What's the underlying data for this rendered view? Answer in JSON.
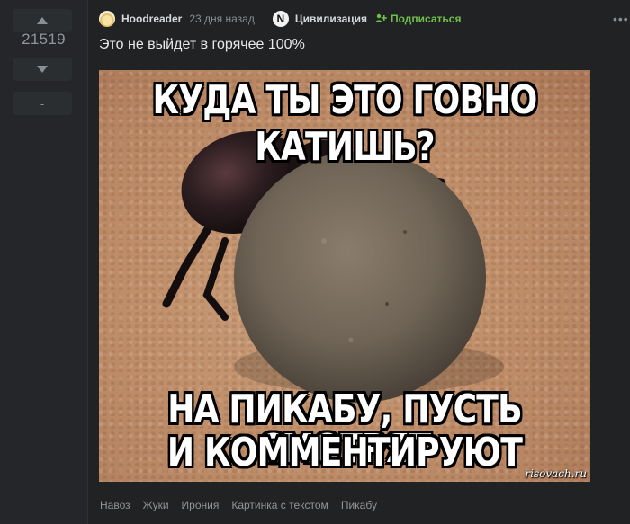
{
  "vote": {
    "rating": "21519",
    "minus_label": "-"
  },
  "header": {
    "author": "Hoodreader",
    "time": "23 дня назад",
    "community_icon_letter": "N",
    "community": "Цивилизация",
    "subscribe": "Подписаться",
    "subscribe_color": "#6fbf4a"
  },
  "story": {
    "title": "Это не выйдет в горячее 100%"
  },
  "meme": {
    "top_line_1": "КУДА ТЫ ЭТО ГОВНО",
    "top_line_2": "КАТИШЬ?",
    "bottom_line_1": "НА ПИКАБУ, ПУСТЬ СМОТРЯТ",
    "bottom_line_2": "И КОММЕНТИРУЮТ",
    "watermark": "risovach.ru"
  },
  "tags": [
    "Навоз",
    "Жуки",
    "Ирония",
    "Картинка с текстом",
    "Пикабу"
  ],
  "colors": {
    "background": "#202224",
    "sidebar": "#242629",
    "text_primary": "#e6e8ea",
    "text_muted": "#8f959a",
    "accent_green": "#6fbf4a"
  },
  "icons": {
    "more": "more-dots-icon",
    "vote_up": "triangle-up-icon",
    "vote_down": "triangle-down-icon",
    "subscribe": "subscribe-icon"
  }
}
